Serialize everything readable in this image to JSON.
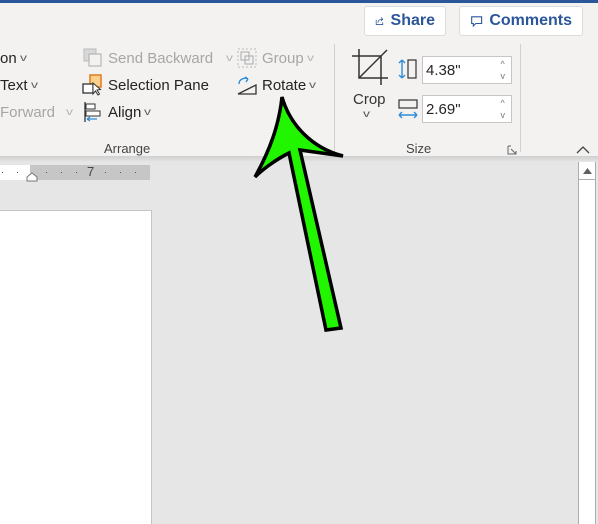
{
  "header": {
    "share_label": "Share",
    "comments_label": "Comments"
  },
  "arrange_left_partial": {
    "items": [
      {
        "label": "on",
        "disabled": false
      },
      {
        "label": "Text",
        "disabled": false
      },
      {
        "label": "Forward",
        "disabled": true
      }
    ]
  },
  "arrange": {
    "group_label": "Arrange",
    "send_backward_label": "Send Backward",
    "selection_pane_label": "Selection Pane",
    "align_label": "Align",
    "group_btn_label": "Group",
    "rotate_label": "Rotate"
  },
  "size": {
    "group_label": "Size",
    "crop_label": "Crop",
    "height_value": "4.38\"",
    "width_value": "2.69\""
  },
  "ruler": {
    "label": "7"
  },
  "annotation": {
    "type": "arrow",
    "color": "#22f500",
    "points_to": "Rotate"
  }
}
